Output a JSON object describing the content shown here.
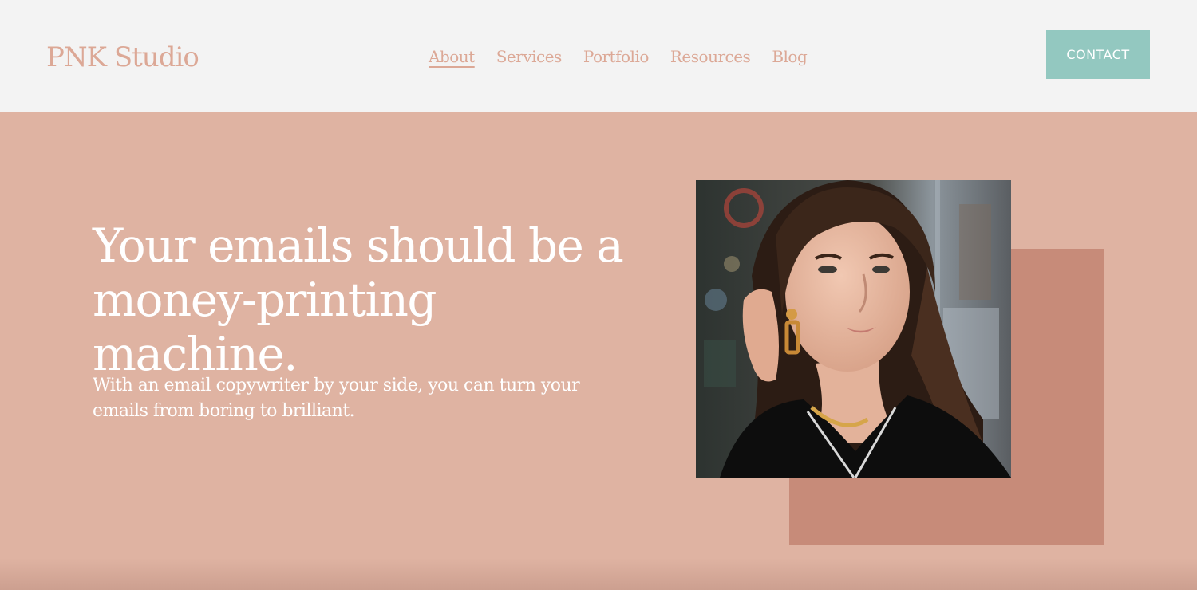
{
  "header": {
    "logo": "PNK Studio",
    "nav": [
      {
        "label": "About",
        "active": true
      },
      {
        "label": "Services",
        "active": false
      },
      {
        "label": "Portfolio",
        "active": false
      },
      {
        "label": "Resources",
        "active": false
      },
      {
        "label": "Blog",
        "active": false
      }
    ],
    "contact_label": "CONTACT"
  },
  "hero": {
    "title_line1": "Your emails should be a",
    "title_line2": "money-printing machine.",
    "subtitle_line1": "With an email copywriter by your side, you can turn your",
    "subtitle_line2": "emails from boring to brilliant."
  },
  "colors": {
    "header_bg": "#f3f3f3",
    "hero_bg": "#dfb3a2",
    "accent_block": "#c78b79",
    "brand_text": "#dca896",
    "contact_button": "#93c8c0"
  },
  "image": {
    "subject": "woman-portrait-photo"
  }
}
